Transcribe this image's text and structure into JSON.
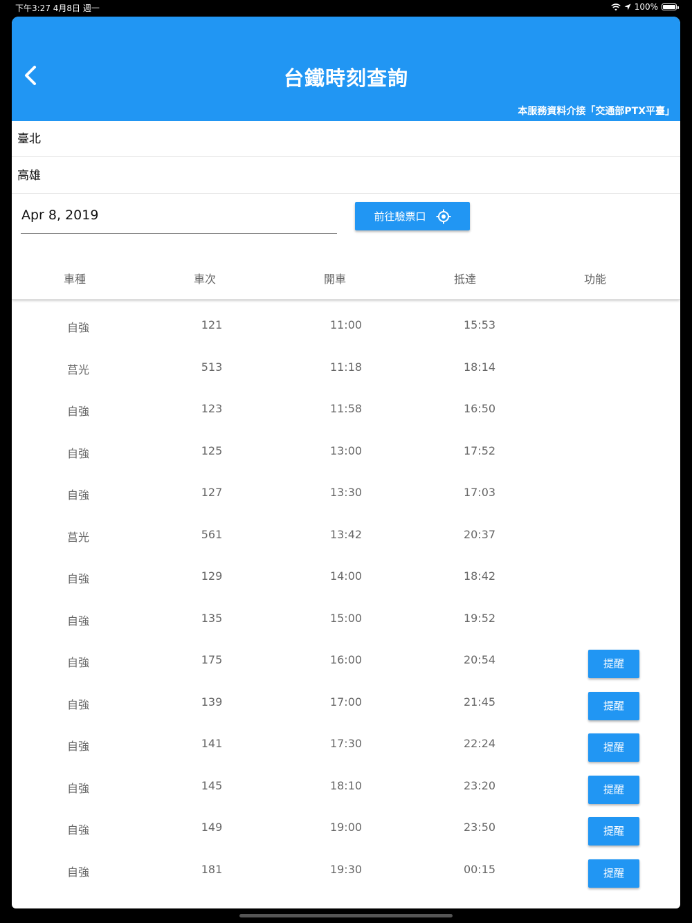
{
  "status_bar": {
    "time_date": "下午3:27   4月8日 週一",
    "battery": "100%"
  },
  "header": {
    "title": "台鐵時刻查詢",
    "subtitle": "本服務資料介接「交通部PTX平臺」"
  },
  "form": {
    "from_station": "臺北",
    "to_station": "高雄",
    "date": "Apr 8, 2019",
    "gate_button_label": "前往驗票口"
  },
  "table": {
    "headers": [
      "車種",
      "車次",
      "開車",
      "抵達",
      "功能"
    ],
    "remind_label": "提醒",
    "rows": [
      {
        "type": "自強",
        "train_no": "121",
        "depart": "11:00",
        "arrive": "15:53",
        "remind": false
      },
      {
        "type": "莒光",
        "train_no": "513",
        "depart": "11:18",
        "arrive": "18:14",
        "remind": false
      },
      {
        "type": "自強",
        "train_no": "123",
        "depart": "11:58",
        "arrive": "16:50",
        "remind": false
      },
      {
        "type": "自強",
        "train_no": "125",
        "depart": "13:00",
        "arrive": "17:52",
        "remind": false
      },
      {
        "type": "自強",
        "train_no": "127",
        "depart": "13:30",
        "arrive": "17:03",
        "remind": false
      },
      {
        "type": "莒光",
        "train_no": "561",
        "depart": "13:42",
        "arrive": "20:37",
        "remind": false
      },
      {
        "type": "自強",
        "train_no": "129",
        "depart": "14:00",
        "arrive": "18:42",
        "remind": false
      },
      {
        "type": "自強",
        "train_no": "135",
        "depart": "15:00",
        "arrive": "19:52",
        "remind": false
      },
      {
        "type": "自強",
        "train_no": "175",
        "depart": "16:00",
        "arrive": "20:54",
        "remind": true
      },
      {
        "type": "自強",
        "train_no": "139",
        "depart": "17:00",
        "arrive": "21:45",
        "remind": true
      },
      {
        "type": "自強",
        "train_no": "141",
        "depart": "17:30",
        "arrive": "22:24",
        "remind": true
      },
      {
        "type": "自強",
        "train_no": "145",
        "depart": "18:10",
        "arrive": "23:20",
        "remind": true
      },
      {
        "type": "自強",
        "train_no": "149",
        "depart": "19:00",
        "arrive": "23:50",
        "remind": true
      },
      {
        "type": "自強",
        "train_no": "181",
        "depart": "19:30",
        "arrive": "00:15",
        "remind": true
      }
    ]
  },
  "colors": {
    "primary": "#2196f3"
  },
  "icons": {
    "back": "chevron-left-icon",
    "gate": "gps-crosshair-icon"
  }
}
